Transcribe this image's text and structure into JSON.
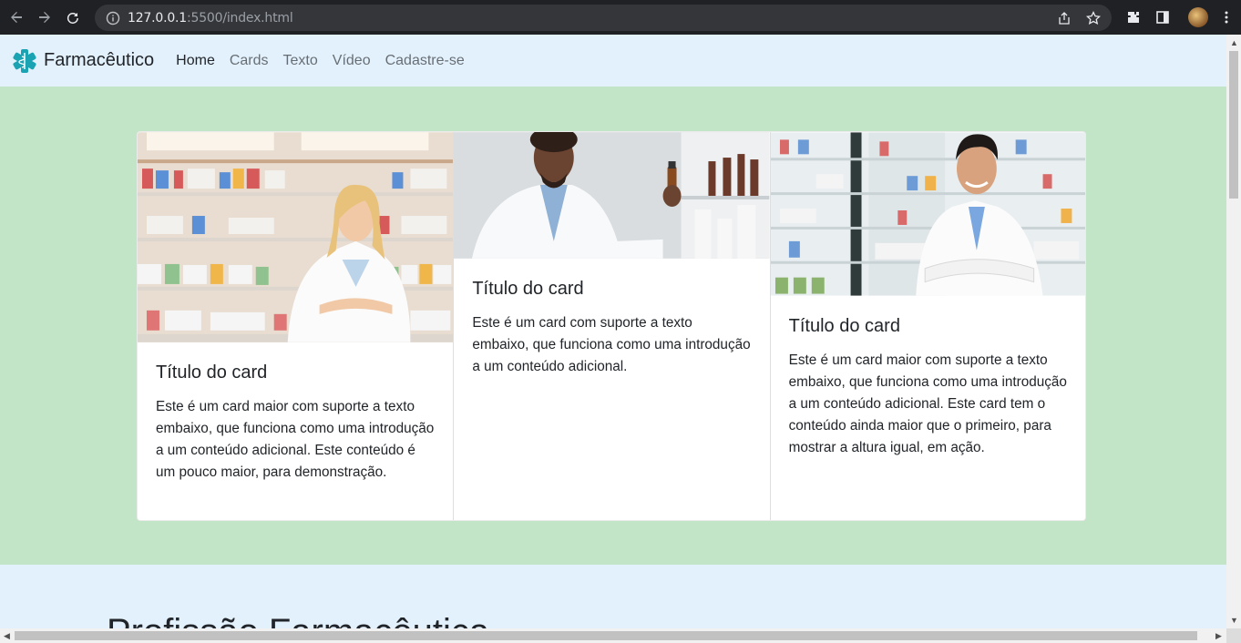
{
  "browser": {
    "url_host": "127.0.0.1",
    "url_rest": ":5500/index.html"
  },
  "navbar": {
    "brand": "Farmacêutico",
    "links": [
      "Home",
      "Cards",
      "Texto",
      "Vídeo",
      "Cadastre-se"
    ],
    "active_index": 0
  },
  "cards": [
    {
      "title": "Título do card",
      "text": "Este é um card maior com suporte a texto embaixo, que funciona como uma introdução a um conteúdo adicional. Este conteúdo é um pouco maior, para demonstração."
    },
    {
      "title": "Título do card",
      "text": "Este é um card com suporte a texto embaixo, que funciona como uma introdução a um conteúdo adicional."
    },
    {
      "title": "Título do card",
      "text": "Este é um card maior com suporte a texto embaixo, que funciona como uma introdução a um conteúdo adicional. Este card tem o conteúdo ainda maior que o primeiro, para mostrar a altura igual, em ação."
    }
  ],
  "section_heading": "Profissão Farmacêutica",
  "colors": {
    "navbar_bg": "#e3f1fd",
    "section_green": "#c2e5c7",
    "brand_icon": "#1aa3b3"
  }
}
